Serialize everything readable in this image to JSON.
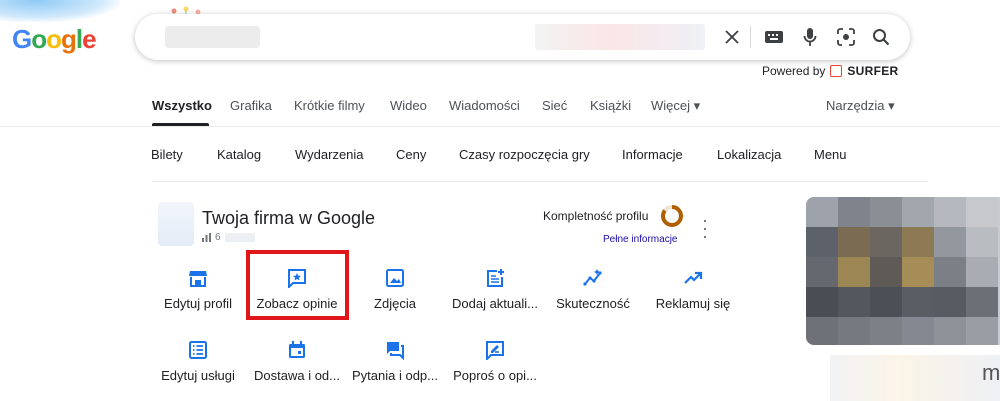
{
  "logo": {
    "letters": [
      "G",
      "o",
      "o",
      "g",
      "l",
      "e"
    ]
  },
  "search": {
    "query": ""
  },
  "powered_by": {
    "label": "Powered by",
    "brand": "SURFER"
  },
  "tabs": [
    "Wszystko",
    "Grafika",
    "Krótkie filmy",
    "Wideo",
    "Wiadomości",
    "Sieć",
    "Książki",
    "Więcej ▾"
  ],
  "tools": "Narzędzia ▾",
  "chips": [
    "Bilety",
    "Katalog",
    "Wydarzenia",
    "Ceny",
    "Czasy rozpoczęcia gry",
    "Informacje",
    "Lokalizacja",
    "Menu"
  ],
  "business": {
    "title": "Twoja firma w Google",
    "stat": "6",
    "completeness_label": "Kompletność profilu",
    "completeness_value": 0.85,
    "full_info_link": "Pełne informacje"
  },
  "actions_row1": [
    {
      "label": "Edytuj profil",
      "icon": "storefront-icon"
    },
    {
      "label": "Zobacz opinie",
      "icon": "star-review-icon"
    },
    {
      "label": "Zdjęcia",
      "icon": "image-icon"
    },
    {
      "label": "Dodaj aktuali...",
      "icon": "post-add-icon"
    },
    {
      "label": "Skuteczność",
      "icon": "insights-icon"
    },
    {
      "label": "Reklamuj się",
      "icon": "trending-up-icon"
    }
  ],
  "actions_row2": [
    {
      "label": "Edytuj usługi",
      "icon": "list-icon"
    },
    {
      "label": "Dostawa i od...",
      "icon": "calendar-icon"
    },
    {
      "label": "Pytania i odp...",
      "icon": "forum-icon"
    },
    {
      "label": "Poproś o opi...",
      "icon": "rate-review-icon"
    }
  ],
  "colors": {
    "accent_blue": "#1a73e8",
    "highlight_red": "#e0161a",
    "ring_orange": "#b06000"
  }
}
